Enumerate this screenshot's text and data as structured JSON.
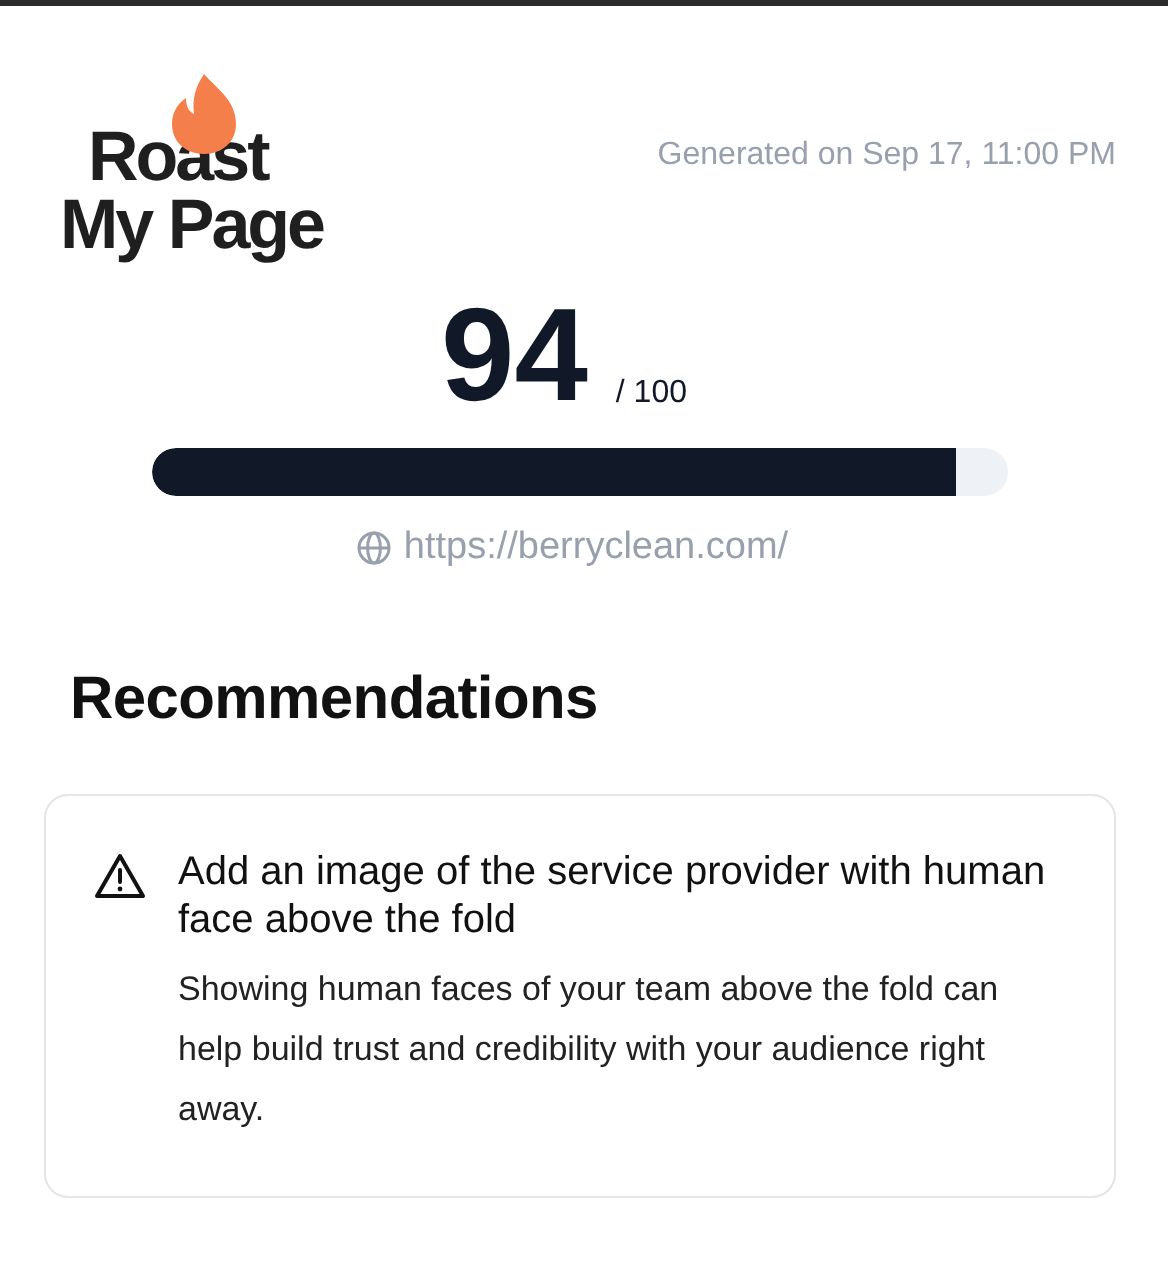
{
  "logo": {
    "lines": [
      "Roast",
      "My Page"
    ]
  },
  "generated": "Generated on Sep 17, 11:00 PM",
  "score": {
    "value": "94",
    "out_of": "/ 100",
    "level": 0.94
  },
  "url": "https://berryclean.com/",
  "section_title": "Recommendations",
  "recommendations": [
    {
      "kind": "warning",
      "title": "Add an image of the service provider with human face above the fold",
      "body": "Showing human faces of your team above the fold can help build trust and credibility with your audience right away."
    }
  ]
}
